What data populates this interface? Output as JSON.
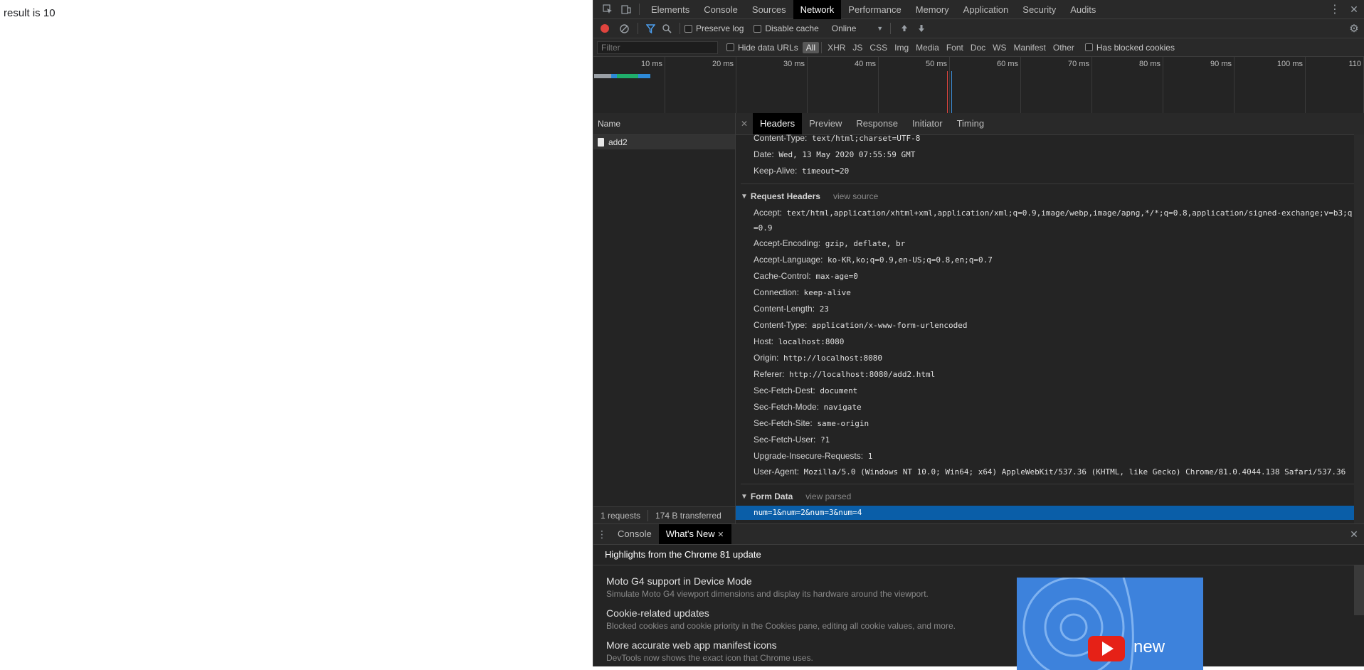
{
  "page": {
    "result_text": "result is 10"
  },
  "devtools": {
    "tabs": [
      "Elements",
      "Console",
      "Sources",
      "Network",
      "Performance",
      "Memory",
      "Application",
      "Security",
      "Audits"
    ],
    "active_tab": "Network",
    "toolbar": {
      "preserve_log": "Preserve log",
      "disable_cache": "Disable cache",
      "throttle": "Online"
    },
    "filter": {
      "placeholder": "Filter",
      "hide_data_urls": "Hide data URLs",
      "types": [
        "All",
        "XHR",
        "JS",
        "CSS",
        "Img",
        "Media",
        "Font",
        "Doc",
        "WS",
        "Manifest",
        "Other"
      ],
      "active_type": "All",
      "has_blocked_cookies": "Has blocked cookies"
    },
    "timeline": {
      "ticks": [
        "10 ms",
        "20 ms",
        "30 ms",
        "40 ms",
        "50 ms",
        "60 ms",
        "70 ms",
        "80 ms",
        "90 ms",
        "100 ms",
        "110"
      ]
    },
    "requests": {
      "header": "Name",
      "items": [
        "add2"
      ],
      "summary_count": "1 requests",
      "summary_transferred": "174 B transferred"
    },
    "details": {
      "tabs": [
        "Headers",
        "Preview",
        "Response",
        "Initiator",
        "Timing"
      ],
      "active_tab": "Headers",
      "response_headers": [
        {
          "k": "Content-Type:",
          "v": "text/html;charset=UTF-8"
        },
        {
          "k": "Date:",
          "v": "Wed, 13 May 2020 07:55:59 GMT"
        },
        {
          "k": "Keep-Alive:",
          "v": "timeout=20"
        }
      ],
      "request_headers_title": "Request Headers",
      "view_source": "view source",
      "request_headers": [
        {
          "k": "Accept:",
          "v": "text/html,application/xhtml+xml,application/xml;q=0.9,image/webp,image/apng,*/*;q=0.8,application/signed-exchange;v=b3;q=0.9"
        },
        {
          "k": "Accept-Encoding:",
          "v": "gzip, deflate, br"
        },
        {
          "k": "Accept-Language:",
          "v": "ko-KR,ko;q=0.9,en-US;q=0.8,en;q=0.7"
        },
        {
          "k": "Cache-Control:",
          "v": "max-age=0"
        },
        {
          "k": "Connection:",
          "v": "keep-alive"
        },
        {
          "k": "Content-Length:",
          "v": "23"
        },
        {
          "k": "Content-Type:",
          "v": "application/x-www-form-urlencoded"
        },
        {
          "k": "Host:",
          "v": "localhost:8080"
        },
        {
          "k": "Origin:",
          "v": "http://localhost:8080"
        },
        {
          "k": "Referer:",
          "v": "http://localhost:8080/add2.html"
        },
        {
          "k": "Sec-Fetch-Dest:",
          "v": "document"
        },
        {
          "k": "Sec-Fetch-Mode:",
          "v": "navigate"
        },
        {
          "k": "Sec-Fetch-Site:",
          "v": "same-origin"
        },
        {
          "k": "Sec-Fetch-User:",
          "v": "?1"
        },
        {
          "k": "Upgrade-Insecure-Requests:",
          "v": "1"
        },
        {
          "k": "User-Agent:",
          "v": "Mozilla/5.0 (Windows NT 10.0; Win64; x64) AppleWebKit/537.36 (KHTML, like Gecko) Chrome/81.0.4044.138 Safari/537.36"
        }
      ],
      "form_data_title": "Form Data",
      "view_parsed": "view parsed",
      "form_data_value": "num=1&num=2&num=3&num=4"
    },
    "drawer": {
      "tabs": [
        "Console",
        "What's New"
      ],
      "active_tab": "What's New",
      "heading": "Highlights from the Chrome 81 update",
      "items": [
        {
          "title": "Moto G4 support in Device Mode",
          "desc": "Simulate Moto G4 viewport dimensions and display its hardware around the viewport."
        },
        {
          "title": "Cookie-related updates",
          "desc": "Blocked cookies and cookie priority in the Cookies pane, editing all cookie values, and more."
        },
        {
          "title": "More accurate web app manifest icons",
          "desc": "DevTools now shows the exact icon that Chrome uses."
        }
      ],
      "promo_text": "new"
    },
    "colors": {
      "accent": "#0a5ea8",
      "record": "#e0443e",
      "panel_bg": "#242424"
    }
  }
}
